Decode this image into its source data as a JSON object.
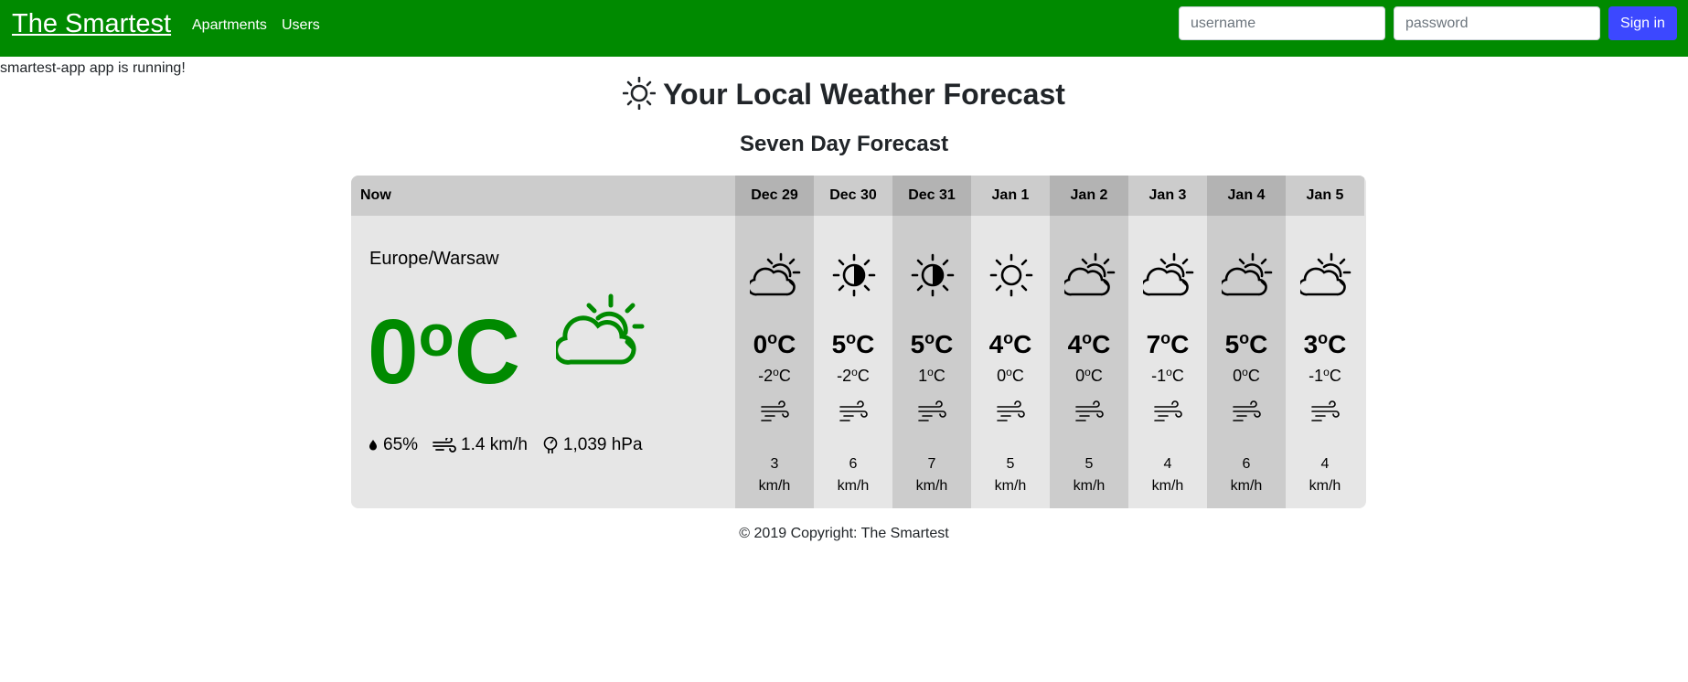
{
  "navbar": {
    "brand": "The Smartest",
    "links": [
      "Apartments",
      "Users"
    ],
    "username_placeholder": "username",
    "password_placeholder": "password",
    "signin_label": "Sign in",
    "color": "#008a00"
  },
  "status_text": "smartest-app app is running!",
  "page_title": "Your Local Weather Forecast",
  "subtitle": "Seven Day Forecast",
  "current": {
    "header": "Now",
    "city": "Europe/Warsaw",
    "temp_value": "0",
    "temp_unit": "C",
    "icon": "partly-cloudy-icon",
    "humidity": "65%",
    "wind": "1.4 km/h",
    "pressure": "1,039 hPa"
  },
  "days": [
    {
      "date": "Dec 29",
      "icon": "partly-cloudy-icon",
      "high": "0",
      "low": "-2",
      "wind_speed": "3",
      "wind_unit": "km/h"
    },
    {
      "date": "Dec 30",
      "icon": "sun-moon-icon",
      "high": "5",
      "low": "-2",
      "wind_speed": "6",
      "wind_unit": "km/h"
    },
    {
      "date": "Dec 31",
      "icon": "sun-moon-icon",
      "high": "5",
      "low": "1",
      "wind_speed": "7",
      "wind_unit": "km/h"
    },
    {
      "date": "Jan 1",
      "icon": "sun-icon",
      "high": "4",
      "low": "0",
      "wind_speed": "5",
      "wind_unit": "km/h"
    },
    {
      "date": "Jan 2",
      "icon": "partly-cloudy-icon",
      "high": "4",
      "low": "0",
      "wind_speed": "5",
      "wind_unit": "km/h"
    },
    {
      "date": "Jan 3",
      "icon": "partly-cloudy-icon",
      "high": "7",
      "low": "-1",
      "wind_speed": "4",
      "wind_unit": "km/h"
    },
    {
      "date": "Jan 4",
      "icon": "partly-cloudy-icon",
      "high": "5",
      "low": "0",
      "wind_speed": "6",
      "wind_unit": "km/h"
    },
    {
      "date": "Jan 5",
      "icon": "partly-cloudy-icon",
      "high": "3",
      "low": "-1",
      "wind_speed": "4",
      "wind_unit": "km/h"
    }
  ],
  "degree_symbol": "o",
  "unit": "C",
  "footer": "© 2019 Copyright: The Smartest"
}
